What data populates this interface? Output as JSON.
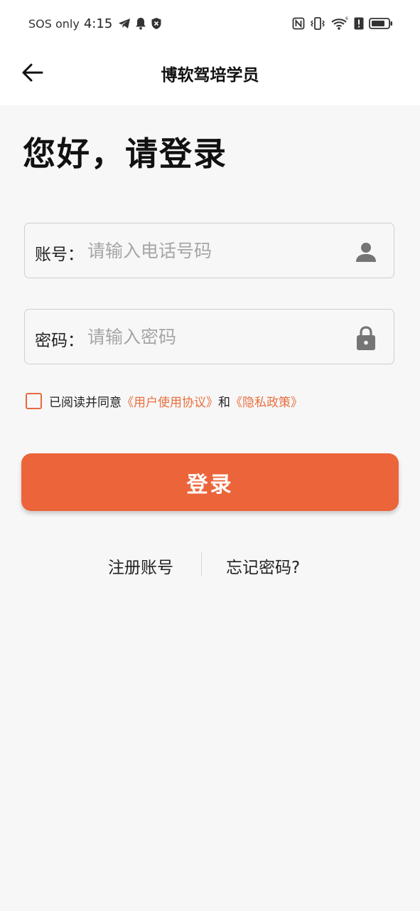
{
  "status_bar": {
    "carrier": "SOS only",
    "time": "4:15",
    "icons_left": [
      "telegram-icon",
      "bell-icon",
      "shield-icon"
    ],
    "icons_right": [
      "nfc-icon",
      "vibrate-icon",
      "wifi-icon",
      "alert-icon",
      "battery-icon"
    ],
    "wifi_badge": "6"
  },
  "nav": {
    "title": "博软驾培学员"
  },
  "greeting": "您好，请登录",
  "account": {
    "label": "账号：",
    "placeholder": "请输入电话号码",
    "value": ""
  },
  "password": {
    "label": "密码：",
    "placeholder": "请输入密码",
    "value": ""
  },
  "agreement": {
    "prefix": "已阅读并同意",
    "user_agreement": "《用户使用协议》",
    "and": "和",
    "privacy_policy": "《隐私政策》",
    "checked": false
  },
  "login_button": "登录",
  "links": {
    "register": "注册账号",
    "forgot": "忘记密码?"
  },
  "colors": {
    "accent": "#ec6439",
    "link": "#e8703f",
    "border": "#cfcfcf",
    "background": "#f7f7f7"
  }
}
